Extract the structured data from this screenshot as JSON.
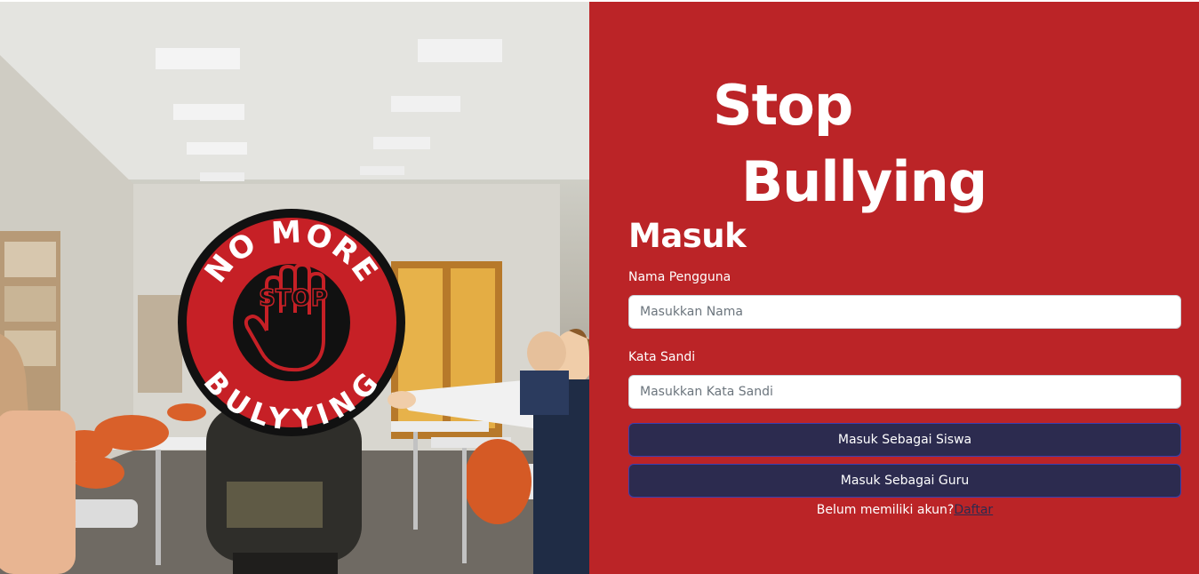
{
  "hero": {
    "line1": "Stop",
    "line2": "Bullying"
  },
  "badge": {
    "top_text": "NO MORE",
    "center_text": "STOP",
    "bottom_text": "BULYYING"
  },
  "form": {
    "title": "Masuk",
    "username_label": "Nama Pengguna",
    "username_placeholder": "Masukkan Nama",
    "password_label": "Kata Sandi",
    "password_placeholder": "Masukkan Kata Sandi",
    "student_button": "Masuk Sebagai Siswa",
    "teacher_button": "Masuk Sebagai Guru",
    "signup_prompt": "Belum memiliki akun?",
    "signup_link": "Daftar"
  },
  "colors": {
    "panel_red": "#bb2427",
    "button_navy": "#2c2b4f",
    "badge_red": "#c62026",
    "badge_black": "#111111"
  }
}
